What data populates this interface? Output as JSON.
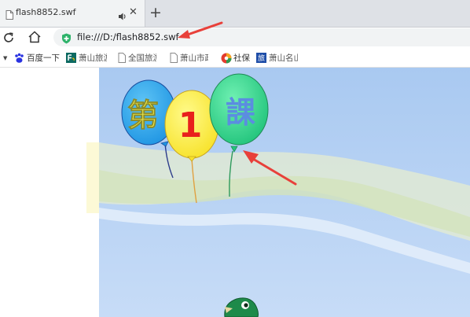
{
  "tab": {
    "title": "flash8852.swf",
    "icon": "file-icon",
    "audio_icon": "speaker-icon",
    "close_glyph": "✕"
  },
  "new_tab_glyph": "+",
  "address": {
    "url": "file:///D:/flash8852.swf",
    "secure_icon": "shield-check-icon",
    "accent_color": "#2fb36b"
  },
  "bookmarks": [
    {
      "label": "百度一下",
      "icon": "baidu-paw-icon"
    },
    {
      "label": "萧山旅游",
      "icon": "site-logo-icon"
    },
    {
      "label": "全国旅游",
      "icon": "page-icon"
    },
    {
      "label": "萧山市政",
      "icon": "page-icon"
    },
    {
      "label": "社保",
      "icon": "social-security-icon"
    },
    {
      "label": "萧山名山",
      "icon": "travel-logo-icon"
    }
  ],
  "flash": {
    "balloon_chars": [
      "第",
      "1",
      "課"
    ],
    "balloon_colors": [
      "#29a8ee",
      "#fbee3c",
      "#2ed28c"
    ],
    "sky_color": "#b4d1f3",
    "annotation_color": "#e8403a"
  }
}
